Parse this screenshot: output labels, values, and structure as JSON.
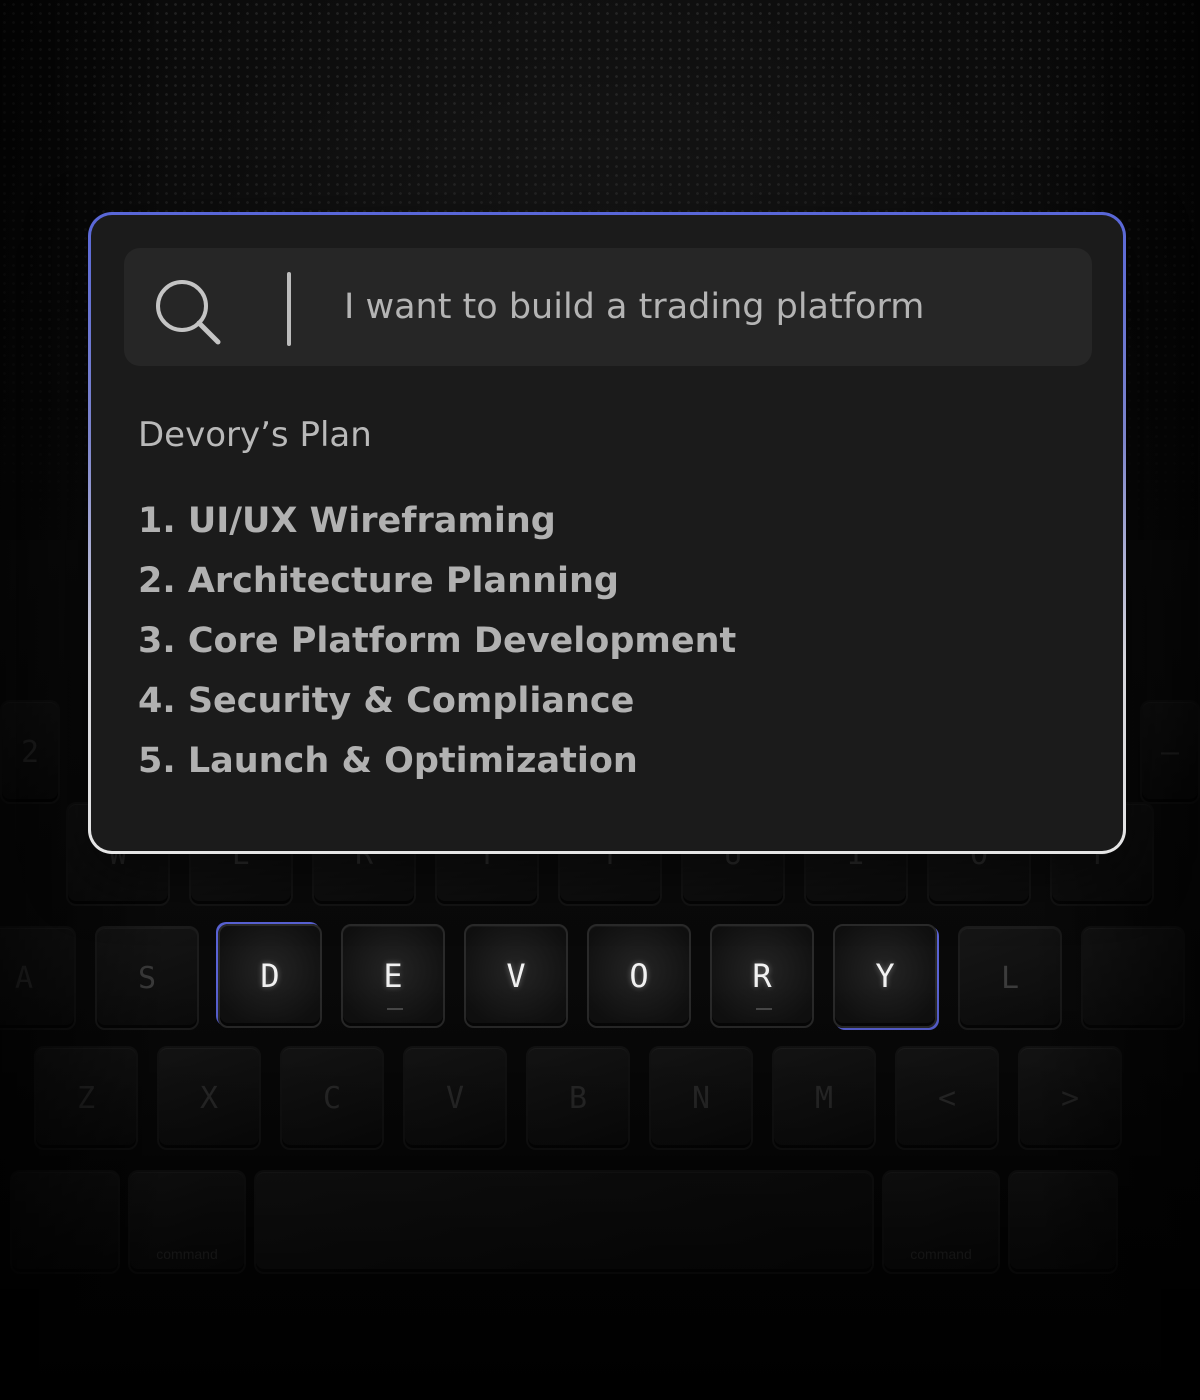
{
  "search": {
    "value": "I want to build a trading platform",
    "icon": "search-icon"
  },
  "plan": {
    "title": "Devory’s Plan",
    "items": [
      "1. UI/UX Wireframing",
      "2. Architecture Planning",
      "3. Core Platform Development",
      "4. Security & Compliance",
      "5. Launch & Optimization"
    ]
  },
  "keyboard": {
    "row_top": [
      "W",
      "E",
      "R",
      "T",
      "Y",
      "U",
      "I",
      "O",
      "P"
    ],
    "row_home": [
      "A",
      "S",
      "D",
      "E",
      "V",
      "O",
      "R",
      "Y",
      "L"
    ],
    "row_bottom": [
      "Z",
      "X",
      "C",
      "V",
      "B",
      "N",
      "M",
      "<",
      ">"
    ],
    "row_number_partial": [
      "@",
      "2"
    ],
    "row_modifiers": [
      "⌘",
      "command",
      "⌘",
      "command"
    ]
  },
  "colors": {
    "accent": "#5a63d6",
    "panel_bg": "#1b1b1b",
    "search_bg": "#262626",
    "text": "#b1b1b1"
  }
}
